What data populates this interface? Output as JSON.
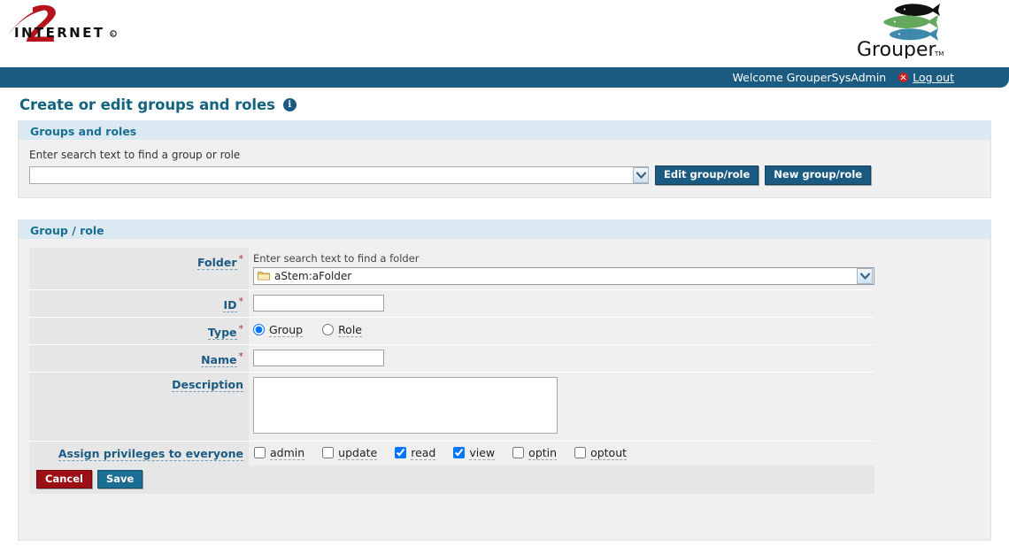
{
  "branding": {
    "internet2_text": "INTERNET",
    "internet2_mark": "2",
    "internet2_reg": "®",
    "grouper_text": "Grouper",
    "grouper_tm": "TM"
  },
  "topbar": {
    "welcome_text": "Welcome GrouperSysAdmin",
    "logout_label": "Log out",
    "logout_icon": "error-circle-icon"
  },
  "page": {
    "title": "Create or edit groups and roles",
    "info_icon": "info-icon",
    "info_glyph": "i"
  },
  "search_panel": {
    "header": "Groups and roles",
    "field_label": "Enter search text to find a group or role",
    "input_value": "",
    "input_placeholder": "",
    "edit_button": "Edit group/role",
    "new_button": "New group/role"
  },
  "form_panel": {
    "header": "Group / role",
    "required_marker": "*",
    "folder": {
      "label": "Folder",
      "hint": "Enter search text to find a folder",
      "value": "aStem:aFolder",
      "icon": "folder-icon"
    },
    "id": {
      "label": "ID",
      "value": "",
      "placeholder": ""
    },
    "type": {
      "label": "Type",
      "options": [
        {
          "label": "Group",
          "selected": true
        },
        {
          "label": "Role",
          "selected": false
        }
      ]
    },
    "name": {
      "label": "Name",
      "value": "",
      "placeholder": ""
    },
    "description": {
      "label": "Description",
      "value": "",
      "placeholder": ""
    },
    "privileges": {
      "label": "Assign privileges to everyone",
      "items": [
        {
          "label": "admin",
          "checked": false
        },
        {
          "label": "update",
          "checked": false
        },
        {
          "label": "read",
          "checked": true
        },
        {
          "label": "view",
          "checked": true
        },
        {
          "label": "optin",
          "checked": false
        },
        {
          "label": "optout",
          "checked": false
        }
      ]
    },
    "actions": {
      "cancel_label": "Cancel",
      "save_label": "Save"
    }
  },
  "colors": {
    "header_bar": "#1b5b82",
    "panel_header_bg": "#dbeaf2",
    "panel_header_text": "#1b6e93",
    "title_text": "#14637f",
    "link_text": "#1b5b82",
    "required_red": "#aa3333",
    "cancel_red": "#9c0f15",
    "save_blue": "#1b6e93",
    "logo_red": "#b5121b",
    "fish_green": "#63a85c",
    "fish_blue": "#3d8aad"
  }
}
